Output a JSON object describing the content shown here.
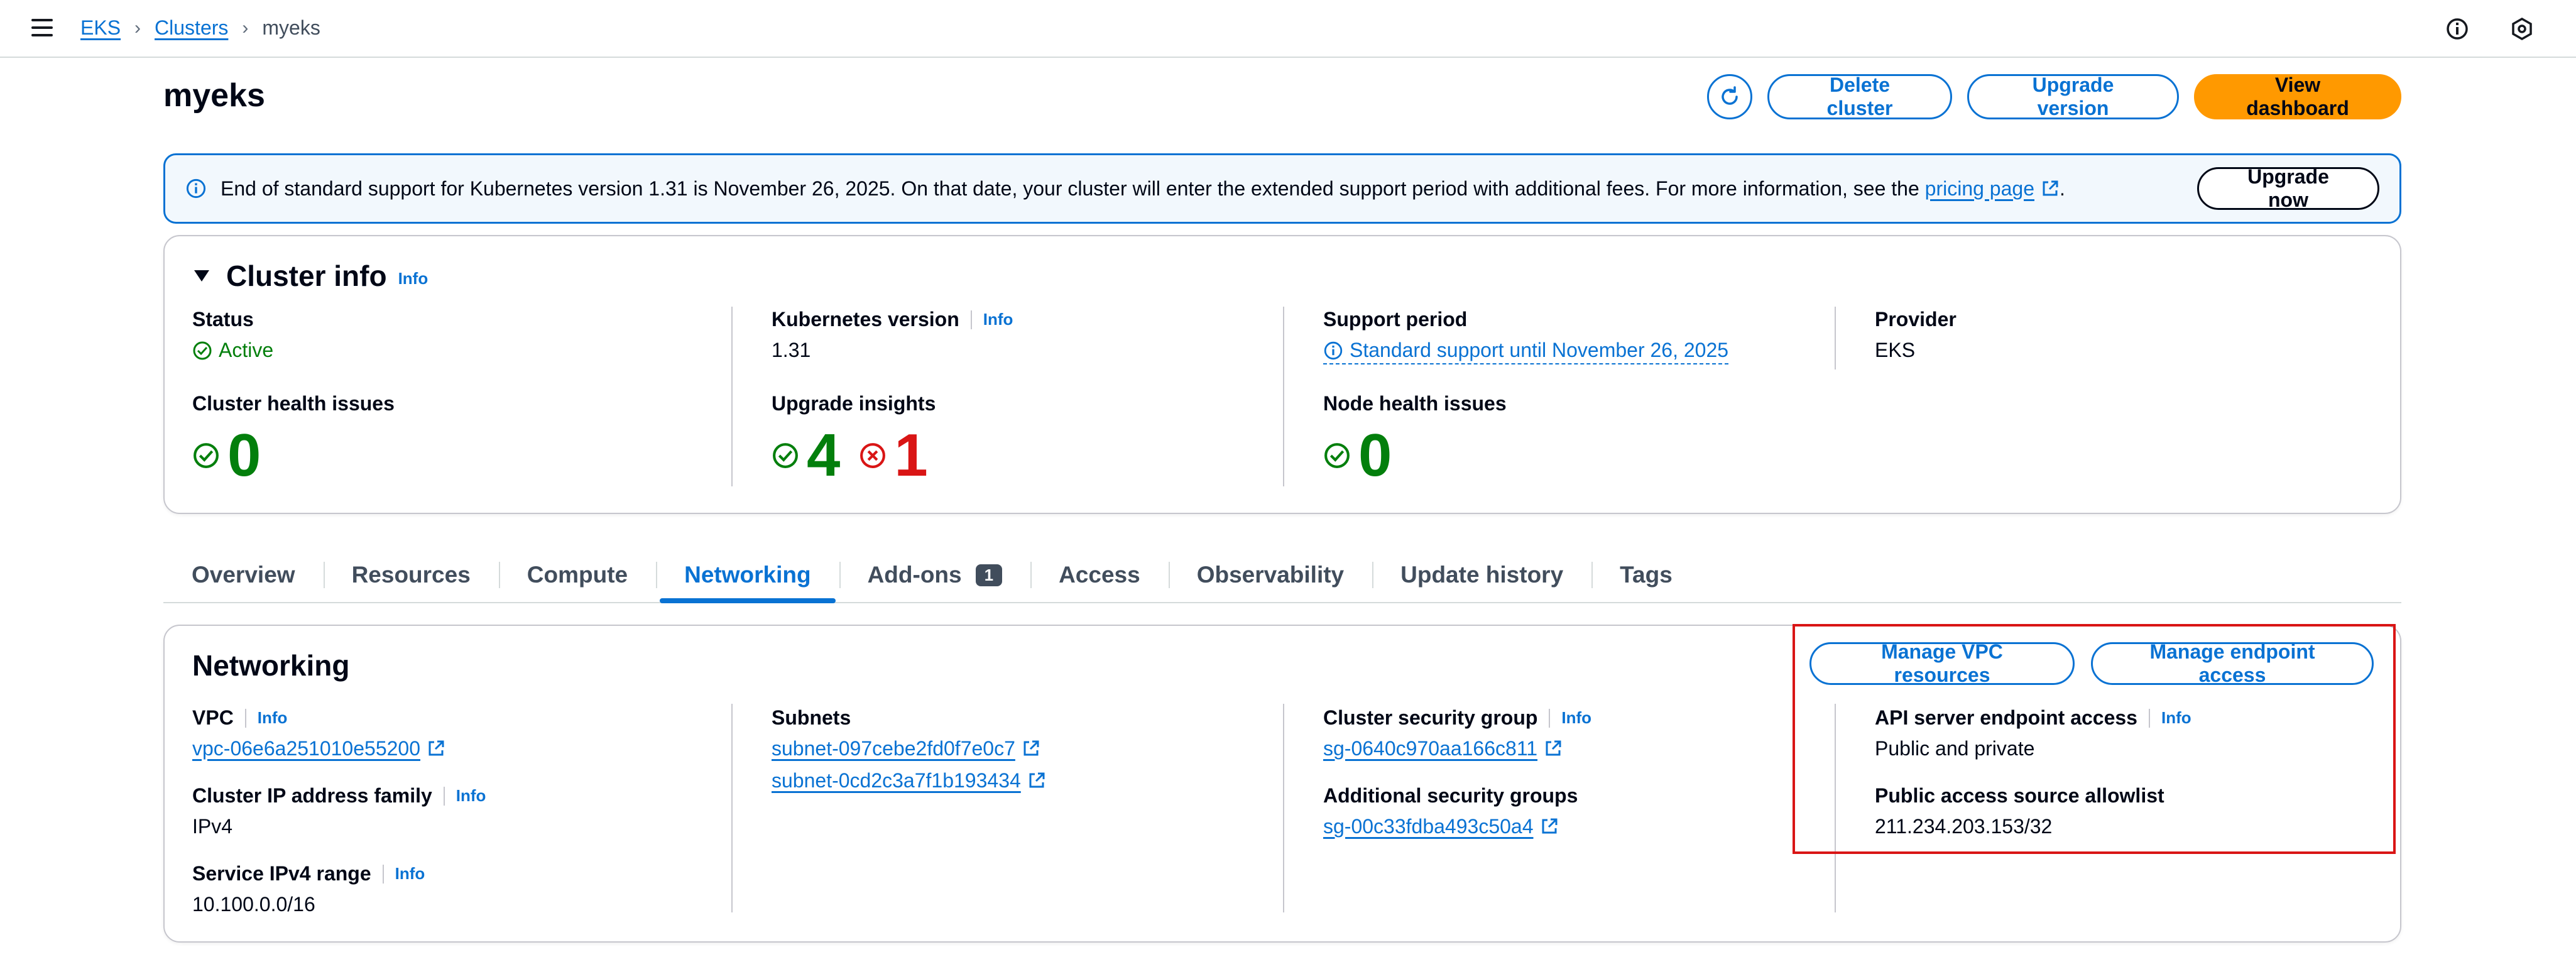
{
  "nav": {
    "breadcrumb": [
      "EKS",
      "Clusters",
      "myeks"
    ]
  },
  "header": {
    "title": "myeks",
    "delete_label": "Delete cluster",
    "upgrade_label": "Upgrade version",
    "dashboard_label": "View dashboard"
  },
  "flash": {
    "text": "End of standard support for Kubernetes version 1.31 is November 26, 2025. On that date, your cluster will enter the extended support period with additional fees. For more information, see the",
    "link": "pricing page",
    "suffix": ".",
    "button": "Upgrade now"
  },
  "cluster_info": {
    "title": "Cluster info",
    "info": "Info",
    "status_label": "Status",
    "status_value": "Active",
    "k8s_label": "Kubernetes version",
    "k8s_info": "Info",
    "k8s_value": "1.31",
    "support_label": "Support period",
    "support_value": "Standard support until November 26, 2025",
    "provider_label": "Provider",
    "provider_value": "EKS",
    "health_label": "Cluster health issues",
    "health_value": "0",
    "insights_label": "Upgrade insights",
    "insights_ok": "4",
    "insights_err": "1",
    "node_label": "Node health issues",
    "node_value": "0"
  },
  "tabs": [
    {
      "label": "Overview"
    },
    {
      "label": "Resources"
    },
    {
      "label": "Compute"
    },
    {
      "label": "Networking",
      "active": true
    },
    {
      "label": "Add-ons",
      "badge": "1"
    },
    {
      "label": "Access"
    },
    {
      "label": "Observability"
    },
    {
      "label": "Update history"
    },
    {
      "label": "Tags"
    }
  ],
  "networking": {
    "title": "Networking",
    "manage_vpc": "Manage VPC resources",
    "manage_endpoint": "Manage endpoint access",
    "vpc_label": "VPC",
    "vpc_info": "Info",
    "vpc_value": "vpc-06e6a251010e55200",
    "ip_family_label": "Cluster IP address family",
    "ip_family_info": "Info",
    "ip_family_value": "IPv4",
    "ipv4_range_label": "Service IPv4 range",
    "ipv4_range_info": "Info",
    "ipv4_range_value": "10.100.0.0/16",
    "subnets_label": "Subnets",
    "subnets": [
      "subnet-097cebe2fd0f7e0c7",
      "subnet-0cd2c3a7f1b193434"
    ],
    "csg_label": "Cluster security group",
    "csg_info": "Info",
    "csg_value": "sg-0640c970aa166c811",
    "asg_label": "Additional security groups",
    "asg_value": "sg-00c33fdba493c50a4",
    "api_label": "API server endpoint access",
    "api_info": "Info",
    "api_value": "Public and private",
    "allowlist_label": "Public access source allowlist",
    "allowlist_value": "211.234.203.153/32"
  },
  "colors": {
    "link": "#0972d3",
    "primary": "#ff9900",
    "success": "#037f0c",
    "error": "#d91515",
    "highlight": "#d91515"
  }
}
